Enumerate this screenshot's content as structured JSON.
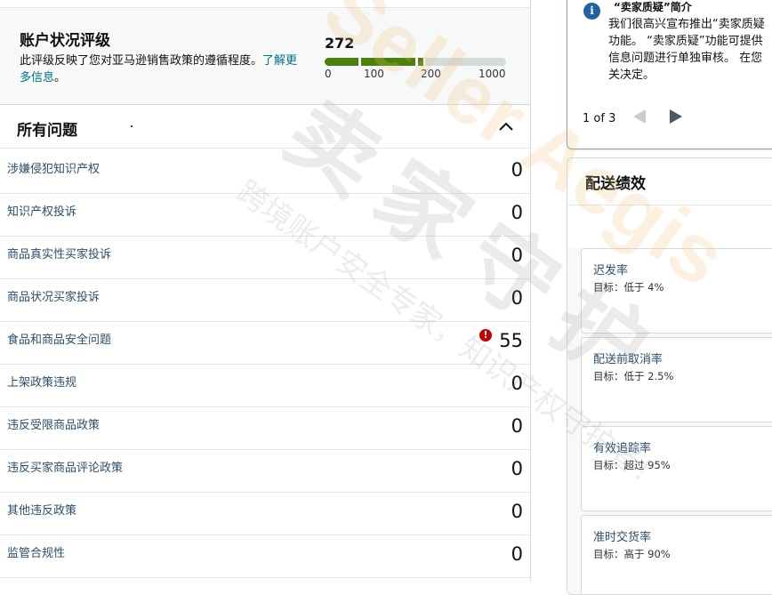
{
  "account_health": {
    "title": "账户状况评级",
    "description": "此评级反映了您对亚马逊销售政策的遵循程度。",
    "link_text": "了解更多信息",
    "description_end": "。",
    "score": "272",
    "score_value": 272,
    "scale_max": 1000,
    "ticks": [
      "0",
      "100",
      "200",
      "1000"
    ],
    "bar_color": "#4b7f0e"
  },
  "issues": {
    "title": "所有问题",
    "rows": [
      {
        "label": "涉嫌侵犯知识产权",
        "count": "0"
      },
      {
        "label": "知识产权投诉",
        "count": "0"
      },
      {
        "label": "商品真实性买家投诉",
        "count": "0"
      },
      {
        "label": "商品状况买家投诉",
        "count": "0"
      },
      {
        "label": "食品和商品安全问题",
        "count": "55",
        "alert": "!"
      },
      {
        "label": "上架政策违规",
        "count": "0"
      },
      {
        "label": "违反受限商品政策",
        "count": "0"
      },
      {
        "label": "违反买家商品评论政策",
        "count": "0"
      },
      {
        "label": "其他违反政策",
        "count": "0"
      },
      {
        "label": "监管合规性",
        "count": "0"
      }
    ]
  },
  "notice": {
    "icon_glyph": "i",
    "title": "“卖家质疑”简介",
    "body": "我们很高兴宣布推出“卖家质疑\n功能。 “卖家质疑”功能可提供\n信息问题进行单独审核。 在您\n关决定。",
    "pager": "1 of 3"
  },
  "delivery": {
    "title": "配送绩效",
    "metrics": [
      {
        "name": "迟发率",
        "target": "目标：低于 4%"
      },
      {
        "name": "配送前取消率",
        "target": "目标：低于 2.5%"
      },
      {
        "name": "有效追踪率",
        "target": "目标：超过 95%"
      },
      {
        "name": "准时交货率",
        "target": "目标：高于 90%"
      }
    ]
  },
  "watermark": {
    "brand": "Seller Aegis",
    "cn": "卖家守护",
    "slogan": "跨境账户安全专家，知识产权守护者！"
  }
}
